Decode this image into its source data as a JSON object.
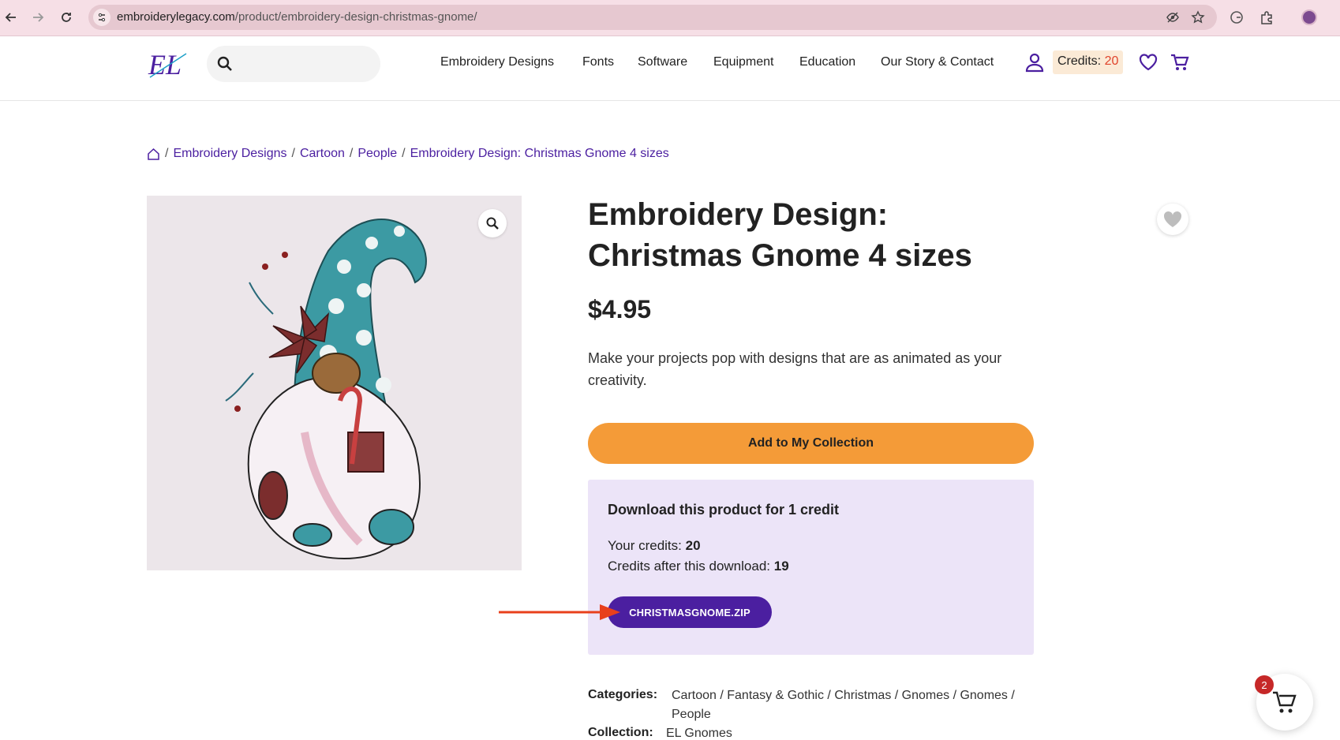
{
  "browser": {
    "url_host": "embroiderylegacy.com",
    "url_path": "/product/embroidery-design-christmas-gnome/"
  },
  "header": {
    "logo_text": "EL",
    "search_placeholder": "",
    "nav": [
      {
        "label": "Embroidery Designs"
      },
      {
        "label": "Fonts"
      },
      {
        "label": "Software"
      },
      {
        "label": "Equipment"
      },
      {
        "label": "Education"
      },
      {
        "label": "Our Story & Contact"
      }
    ],
    "credits_label": "Credits:",
    "credits_value": "20"
  },
  "breadcrumb": {
    "items": [
      {
        "label": "Embroidery Designs"
      },
      {
        "label": "Cartoon"
      },
      {
        "label": "People"
      },
      {
        "label": "Embroidery Design: Christmas Gnome 4 sizes"
      }
    ],
    "separator": "/"
  },
  "product": {
    "title": "Embroidery Design: Christmas Gnome 4 sizes",
    "price": "$4.95",
    "description": "Make your projects pop with designs that are as animated as your creativity.",
    "add_button": "Add to My Collection"
  },
  "download": {
    "title": "Download this product for 1 credit",
    "your_credits_label": "Your credits:",
    "your_credits_value": "20",
    "after_label": "Credits after this download:",
    "after_value": "19",
    "file_button": "CHRISTMASGNOME.ZIP"
  },
  "meta": {
    "categories_label": "Categories:",
    "categories_value": "Cartoon / Fantasy & Gothic / Christmas / Gnomes / Gnomes / People",
    "collection_label": "Collection:",
    "collection_value": "EL Gnomes"
  },
  "floating_cart": {
    "count": "2"
  },
  "colors": {
    "brand_purple": "#4b1fa0",
    "accent_orange": "#f49b38",
    "download_bg": "#ece4f8",
    "arrow_red": "#e8401c",
    "browser_bar": "#f6dfe6"
  }
}
